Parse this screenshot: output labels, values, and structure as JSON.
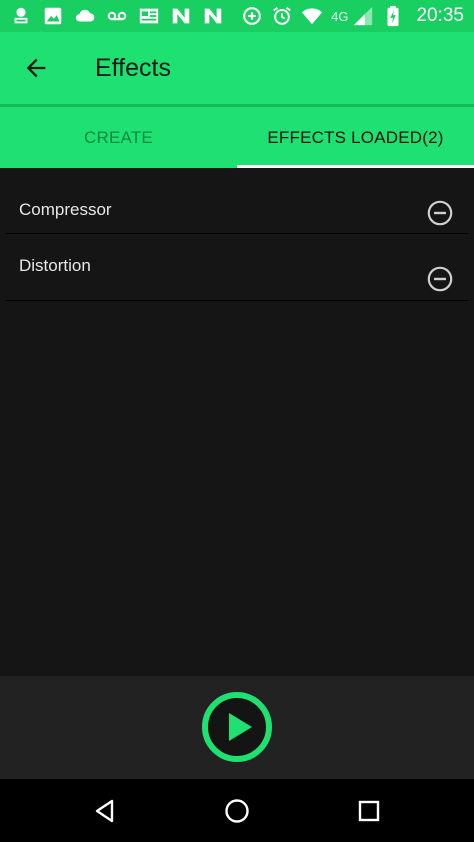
{
  "status_bar": {
    "network_type": "4G",
    "clock": "20:35",
    "icons": [
      "news-icon",
      "image-icon",
      "cloud-icon",
      "voicemail-icon",
      "news-card-icon",
      "n-icon",
      "n-icon",
      "data-saver-icon",
      "alarm-icon",
      "wifi-icon",
      "signal-icon",
      "battery-charging-icon"
    ]
  },
  "app_bar": {
    "title": "Effects",
    "back_icon": "arrow-back-icon"
  },
  "tabs": [
    {
      "label": "CREATE",
      "selected": false
    },
    {
      "label": "EFFECTS LOADED(2)",
      "selected": true
    }
  ],
  "effects": [
    {
      "label": "Compressor",
      "action_icon": "remove-circle-icon"
    },
    {
      "label": "Distortion",
      "action_icon": "remove-circle-icon"
    }
  ],
  "player": {
    "play_icon": "play-icon"
  },
  "nav_bar": {
    "icons": [
      "nav-back-icon",
      "nav-home-icon",
      "nav-recents-icon"
    ]
  },
  "colors": {
    "status_bar": "#19cf62",
    "app_bar": "#1fe171",
    "background": "#151515",
    "player_bar": "#222222",
    "accent": "#1fe171"
  }
}
